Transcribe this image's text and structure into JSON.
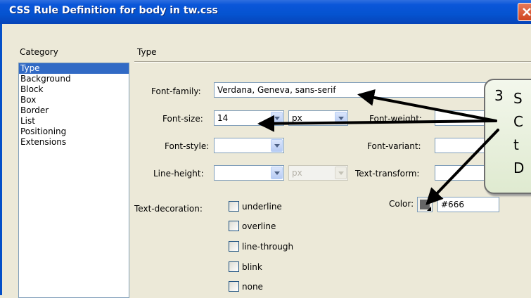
{
  "dialog": {
    "title": "CSS Rule Definition for body in tw.css"
  },
  "category": {
    "label": "Category",
    "items": [
      "Type",
      "Background",
      "Block",
      "Box",
      "Border",
      "List",
      "Positioning",
      "Extensions"
    ],
    "selected": "Type"
  },
  "type_panel": {
    "header": "Type",
    "font_family": {
      "label": "Font-family:",
      "value": "Verdana, Geneva, sans-serif"
    },
    "font_size": {
      "label": "Font-size:",
      "value": "14",
      "unit": "px"
    },
    "font_weight": {
      "label": "Font-weight:"
    },
    "font_style": {
      "label": "Font-style:",
      "value": ""
    },
    "font_variant": {
      "label": "Font-variant:"
    },
    "line_height": {
      "label": "Line-height:",
      "value": "",
      "unit": "px"
    },
    "text_transform": {
      "label": "Text-transform:"
    },
    "text_decoration": {
      "label": "Text-decoration:",
      "options": [
        "underline",
        "overline",
        "line-through",
        "blink",
        "none"
      ]
    },
    "color": {
      "label": "Color:",
      "value": "#666",
      "swatch": "#666666"
    }
  },
  "callout": {
    "number": "3",
    "lines": [
      "S",
      "C",
      "t",
      "D"
    ]
  },
  "colors": {
    "titlebar": "#0553d0",
    "selection": "#316ac5",
    "annotation": "#000000"
  }
}
